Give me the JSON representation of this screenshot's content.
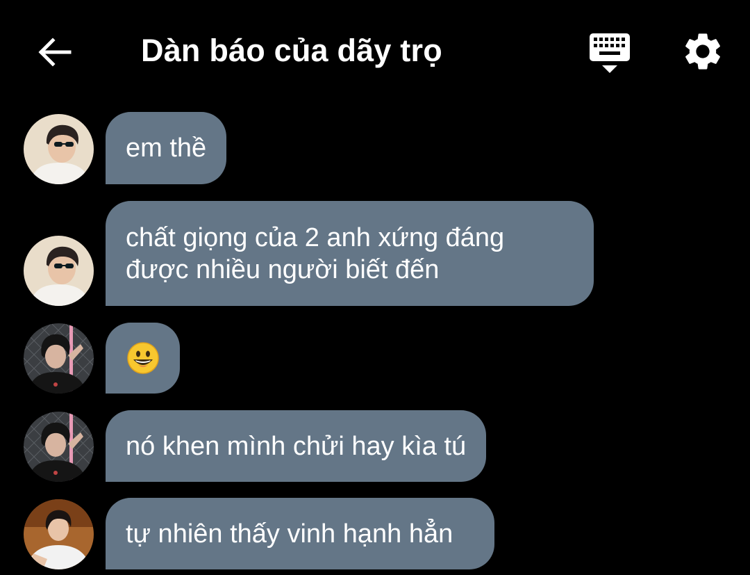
{
  "header": {
    "title": "Dàn báo của dãy trọ",
    "back_icon": "arrow-left-icon",
    "keyboard_icon": "keyboard-hide-icon",
    "settings_icon": "gear-icon"
  },
  "colors": {
    "background": "#000000",
    "bubble": "#647687",
    "text": "#ffffff"
  },
  "messages": [
    {
      "sender_avatar": "avatar-sunglasses-boy",
      "text": "em thề"
    },
    {
      "sender_avatar": "avatar-sunglasses-boy",
      "text": "chất giọng của 2 anh xứng đáng được nhiều người biết đến"
    },
    {
      "sender_avatar": "avatar-black-shirt-boy",
      "text": "",
      "emoji": "grinning-face-emoji"
    },
    {
      "sender_avatar": "avatar-black-shirt-boy",
      "text": "nó khen mình chửi hay kìa tú"
    },
    {
      "sender_avatar": "avatar-white-shirt-boy",
      "text": "tự nhiên thấy vinh hạnh hẳn"
    }
  ]
}
